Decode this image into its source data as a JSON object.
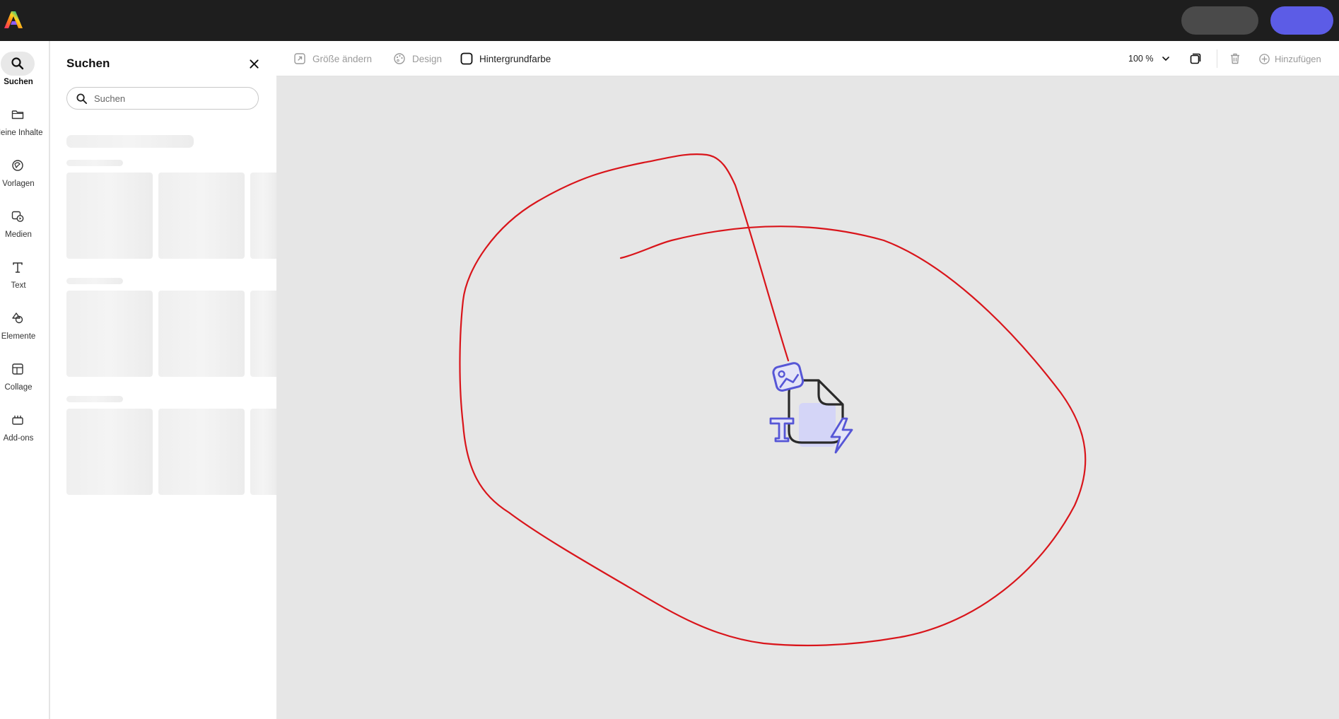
{
  "app": {
    "logo_icon": "adobe-express-logo",
    "accent_color": "#5c5ce6"
  },
  "rail": {
    "items": [
      {
        "label": "Suchen",
        "icon": "search-icon",
        "active": true
      },
      {
        "label": "Meine Inhalte",
        "icon": "folder-icon"
      },
      {
        "label": "Vorlagen",
        "icon": "templates-icon"
      },
      {
        "label": "Medien",
        "icon": "media-icon"
      },
      {
        "label": "Text",
        "icon": "text-icon"
      },
      {
        "label": "Elemente",
        "icon": "shapes-icon"
      },
      {
        "label": "Collage",
        "icon": "collage-icon"
      },
      {
        "label": "Add-ons",
        "icon": "addons-icon"
      }
    ]
  },
  "panel": {
    "title": "Suchen",
    "search_placeholder": "Suchen"
  },
  "toolbar": {
    "resize_label": "Größe ändern",
    "design_label": "Design",
    "background_label": "Hintergrundfarbe",
    "zoom_value": "100 %",
    "add_label": "Hinzufügen"
  },
  "canvas": {
    "background": "#e6e6e6",
    "annotation_color": "#d9151b",
    "placeholder_icon": "empty-document-icon"
  }
}
